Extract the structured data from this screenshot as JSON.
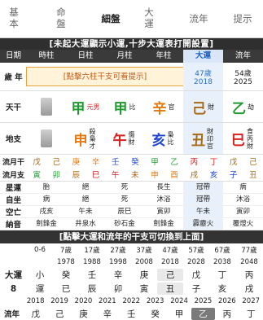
{
  "nav": {
    "tabs": [
      {
        "label_a": "基",
        "label_b": "本"
      },
      {
        "label_a": "命",
        "label_b": "盤"
      },
      {
        "label_a": "細盤",
        "label_b": ""
      },
      {
        "label_a": "大",
        "label_b": "運"
      },
      {
        "label_a": "流年",
        "label_b": ""
      },
      {
        "label_a": "提示",
        "label_b": ""
      }
    ]
  },
  "notice1": "[未起大運顯示小運,十步大運表打開設置]",
  "headers": [
    "日期",
    "時柱",
    "日柱",
    "月柱",
    "年柱",
    "大運",
    "流年"
  ],
  "age": {
    "label": "歲 年",
    "dayun": {
      "age": "47歲",
      "year": "2018"
    },
    "liunian": {
      "age": "54歲",
      "year": "2025"
    },
    "tip": "[點擊六柱干支可看提示]"
  },
  "tiangan": {
    "label": "天干",
    "pillars": [
      {
        "char": "",
        "side": ""
      },
      {
        "char": "甲",
        "side": "元男"
      },
      {
        "char": "甲",
        "side": "比"
      },
      {
        "char": "辛",
        "side": "官"
      },
      {
        "char": "己",
        "side": "財"
      },
      {
        "char": "乙",
        "side": "劫"
      }
    ]
  },
  "dizhi": {
    "label": "地支",
    "pillars": [
      {
        "char": "",
        "side": ""
      },
      {
        "char": "申",
        "side": "殺梟才"
      },
      {
        "char": "午",
        "side": "傷財"
      },
      {
        "char": "亥",
        "side": "梟比"
      },
      {
        "char": "丑",
        "side": "財印官"
      },
      {
        "char": "巳",
        "side": "食丙財"
      }
    ]
  },
  "liuyue_gan": {
    "label": "流月干",
    "cells": [
      "戊",
      "己",
      "庚",
      "辛",
      "壬",
      "癸",
      "甲",
      "乙",
      "丙",
      "丁",
      "戊",
      "己"
    ]
  },
  "liuyue_zhi": {
    "label": "流月支",
    "cells": [
      "寅",
      "卯",
      "辰",
      "巳",
      "午",
      "未",
      "申",
      "酉",
      "戌",
      "亥",
      "子",
      "丑"
    ]
  },
  "xingyun": {
    "label": "星運",
    "cells": [
      "胎",
      "絕",
      "死",
      "長生",
      "冠帶",
      "病"
    ]
  },
  "zizuo": {
    "label": "自坐",
    "cells": [
      "病",
      "絕",
      "死",
      "沐浴",
      "冠帶",
      "沐浴"
    ]
  },
  "kongwang": {
    "label": "空亡",
    "cells": [
      "戌亥",
      "午未",
      "辰巳",
      "寅卯",
      "午未",
      "寅卯"
    ]
  },
  "nayin": {
    "label": "納音",
    "cells": [
      "劍鋒金",
      "井泉水",
      "砂石金",
      "劍鋒金",
      "霹靂火",
      "覆燈火"
    ]
  },
  "notice2": "[點擊大運和流年的干支可切換到上面]",
  "dayun_table": {
    "ages": [
      "0-6",
      "7歲",
      "17歲",
      "27歲",
      "37歲",
      "47歲",
      "57歲",
      "67歲",
      "77歲"
    ],
    "years": [
      "",
      "1978",
      "1988",
      "1998",
      "2008",
      "2018",
      "2028",
      "2038",
      "2048"
    ],
    "label": "大運",
    "num": "8",
    "gan": [
      "小",
      "癸",
      "壬",
      "辛",
      "庚",
      "己",
      "戊",
      "丁",
      "丙"
    ],
    "zhi": [
      "運",
      "已",
      "辰",
      "卯",
      "寅",
      "丑",
      "子",
      "亥",
      "戌"
    ]
  },
  "liunian_years": [
    "2018",
    "2019",
    "2020",
    "2021",
    "2022",
    "2023",
    "2024",
    "2025",
    "2026",
    "2027"
  ],
  "liunian_row": {
    "label": "流年",
    "cells": [
      "戊",
      "己",
      "庚",
      "辛",
      "壬",
      "癸",
      "甲",
      "乙",
      "丙",
      "丁"
    ]
  }
}
